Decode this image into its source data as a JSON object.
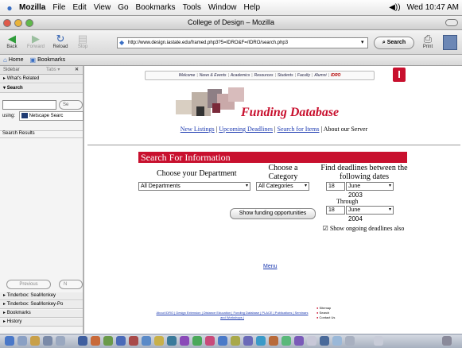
{
  "menubar": {
    "app": "Mozilla",
    "items": [
      "File",
      "Edit",
      "View",
      "Go",
      "Bookmarks",
      "Tools",
      "Window",
      "Help"
    ],
    "clock": "Wed 10:47 AM",
    "volume_icon": "speaker-icon"
  },
  "window": {
    "title": "College of Design – Mozilla"
  },
  "navbar": {
    "back": "Back",
    "forward": "Forward",
    "reload": "Reload",
    "stop": "Stop",
    "url": "http://www.design.iastate.edu/framed.php3?5=IDRO&F=/IDRO/search.php3",
    "search_label": "Search",
    "print_label": "Print"
  },
  "personal_toolbar": {
    "home": "Home",
    "bookmarks": "Bookmarks"
  },
  "sidebar": {
    "header": "Sidebar",
    "tabs_label": "Tabs ▾",
    "whats_related": "What's Related",
    "search": "Search",
    "search_button": "Se",
    "using_label": "using:",
    "engine": "Netscape Searc",
    "results_label": "Search Results",
    "previous": "Previous",
    "next": "N",
    "bottom": [
      "Tinderbox: SeaMonkey",
      "Tinderbox: SeaMonkey-Po",
      "Bookmarks",
      "History"
    ]
  },
  "page": {
    "topnav": [
      "Welcome",
      "News & Events",
      "Academics",
      "Resources",
      "Students",
      "Faculty",
      "Alumni",
      "IDRO"
    ],
    "db_title": "Funding Database",
    "sublinks": [
      "New Listings",
      "Upcoming Deadlines",
      "Search for Items",
      "About our Server"
    ],
    "section_title": "Search For Information",
    "dept_label": "Choose your Department",
    "cat_label": "Choose a Category",
    "dates_label": "Find deadlines between the following dates",
    "dept_value": "All Departments",
    "cat_value": "All Categories",
    "start_day": "18",
    "start_month": "June",
    "start_year": "2003",
    "through": "Through",
    "end_day": "18",
    "end_month": "June",
    "end_year": "2004",
    "show_button": "Show funding opportunities",
    "ongoing": "Show ongoing deadlines also",
    "menu_link": "Menu",
    "footer_links": "About IDRO | Design Extension | Distance Education | Funding Database | PLACE | Publications | Seminars and Workshops |",
    "footer_list": [
      "Sitemap",
      "Search",
      "Contact Us"
    ]
  }
}
